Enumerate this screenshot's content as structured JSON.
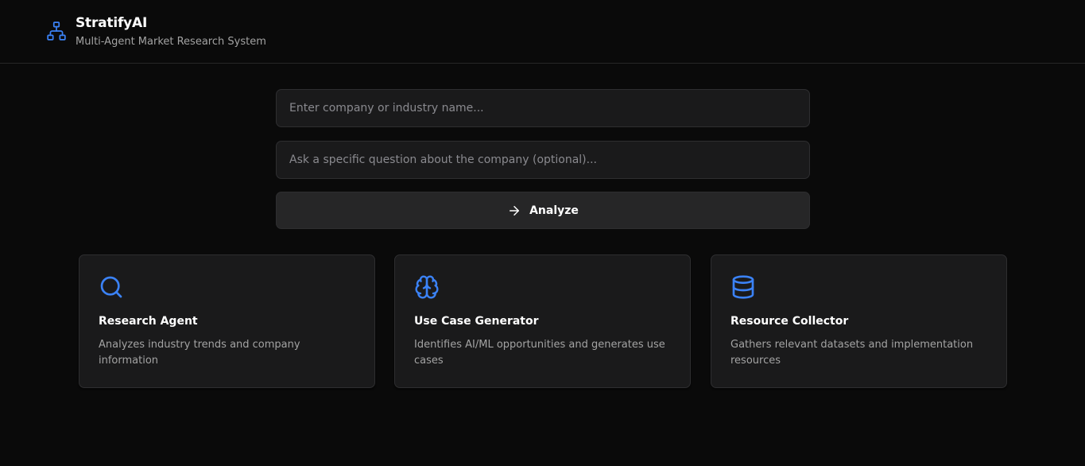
{
  "header": {
    "title": "StratifyAI",
    "subtitle": "Multi-Agent Market Research System",
    "logo_icon": "network-icon"
  },
  "form": {
    "company_placeholder": "Enter company or industry name...",
    "company_value": "",
    "question_placeholder": "Ask a specific question about the company (optional)...",
    "question_value": "",
    "analyze_label": "Analyze",
    "analyze_icon": "arrow-right-icon"
  },
  "agents": [
    {
      "title": "Research Agent",
      "description": "Analyzes industry trends and company information",
      "icon": "search-icon"
    },
    {
      "title": "Use Case Generator",
      "description": "Identifies AI/ML opportunities and generates use cases",
      "icon": "brain-icon"
    },
    {
      "title": "Resource Collector",
      "description": "Gathers relevant datasets and implementation resources",
      "icon": "database-icon"
    }
  ],
  "colors": {
    "accent": "#3b82f6",
    "background": "#0a0a0a",
    "surface": "#1a1a1b"
  }
}
